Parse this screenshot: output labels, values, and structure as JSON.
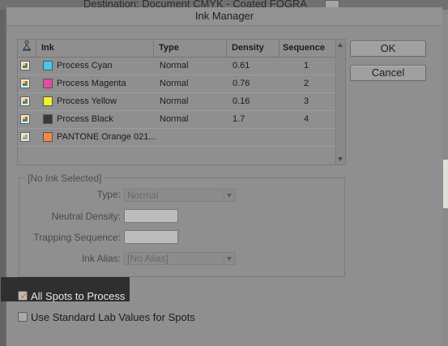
{
  "background": {
    "destination_text": "Destination:  Document CMYK - Coated FOGRA"
  },
  "dialog": {
    "title": "Ink Manager"
  },
  "table": {
    "columns": {
      "ink": "Ink",
      "type": "Type",
      "density": "Density",
      "sequence": "Sequence"
    },
    "rows": [
      {
        "name": "Process Cyan",
        "type": "Normal",
        "density": "0.61",
        "sequence": "1",
        "color": "#45c8f0"
      },
      {
        "name": "Process Magenta",
        "type": "Normal",
        "density": "0.76",
        "sequence": "2",
        "color": "#e64aa6"
      },
      {
        "name": "Process Yellow",
        "type": "Normal",
        "density": "0.16",
        "sequence": "3",
        "color": "#f3f02c"
      },
      {
        "name": "Process Black",
        "type": "Normal",
        "density": "1.7",
        "sequence": "4",
        "color": "#3a3a3a"
      },
      {
        "name": "PANTONE Orange 021...",
        "type": "",
        "density": "",
        "sequence": "",
        "color": "#f2884a"
      }
    ]
  },
  "buttons": {
    "ok": "OK",
    "cancel": "Cancel"
  },
  "details": {
    "group_title": "[No Ink Selected]",
    "type_label": "Type:",
    "type_value": "Normal",
    "neutral_density_label": "Neutral Density:",
    "trapping_sequence_label": "Trapping Sequence:",
    "ink_alias_label": "Ink Alias:",
    "ink_alias_value": "[No Alias]"
  },
  "options": {
    "all_spots_to_process": {
      "label": "All Spots to Process",
      "checked": true
    },
    "use_standard_lab": {
      "label": "Use Standard Lab Values for Spots",
      "checked": false
    }
  }
}
